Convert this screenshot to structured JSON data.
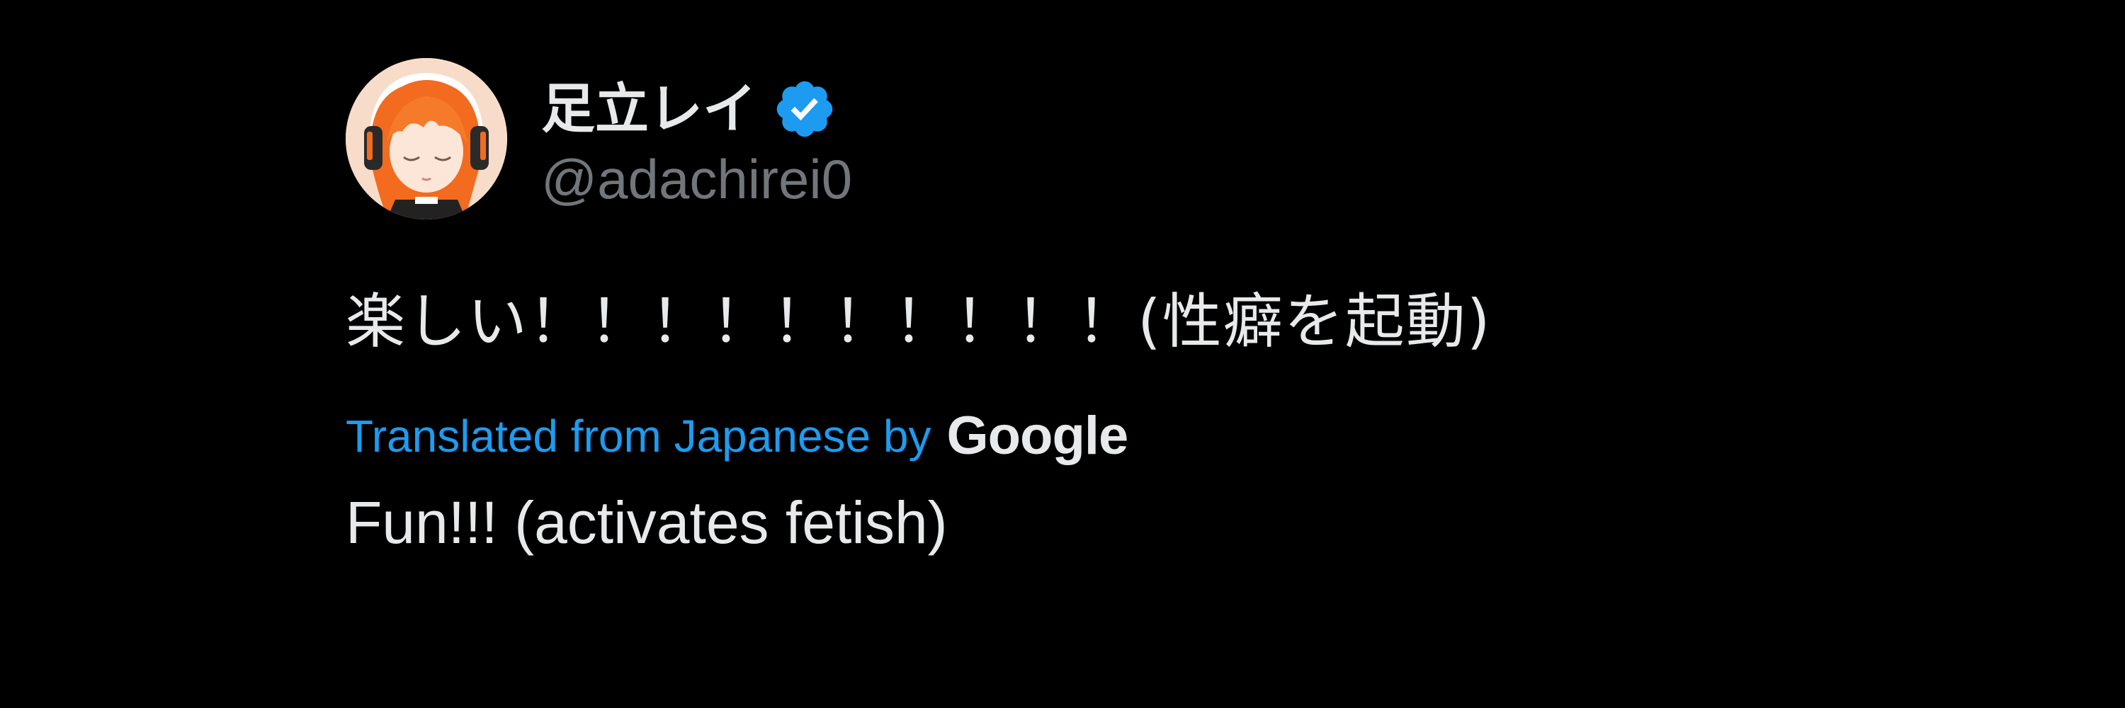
{
  "author": {
    "display_name": "足立レイ",
    "handle": "@adachirei0",
    "verified": true,
    "avatar_icon": "avatar-image",
    "verified_icon": "verified-badge-icon"
  },
  "tweet": {
    "text": "楽しい！！！！！！！！！！(性癖を起動)",
    "translation_label": "Translated from Japanese by",
    "translation_provider": "Google",
    "translated_text": "Fun!!! (activates fetish)"
  },
  "colors": {
    "background": "#000000",
    "accent": "#1d9bf0",
    "text_primary": "#e7e9ea",
    "text_secondary": "#71767b"
  }
}
